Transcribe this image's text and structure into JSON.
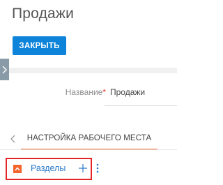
{
  "page": {
    "title": "Продажи"
  },
  "toolbar": {
    "close_label": "ЗАКРЫТЬ"
  },
  "form": {
    "name_field": {
      "label": "Название",
      "required_mark": "*",
      "value": "Продажи"
    }
  },
  "tabs": [
    {
      "label": "НАСТРОЙКА РАБОЧЕГО МЕСТА",
      "active": true
    }
  ],
  "sections": {
    "label": "Разделы",
    "collapsed_state": "expanded"
  },
  "icons": {
    "side_handle": "chevron-right-icon",
    "tab_back": "chevron-left-icon",
    "collapse": "collapse-icon",
    "add": "plus-icon",
    "more": "vertical-dots-icon"
  },
  "colors": {
    "primary_button": "#0d84d9",
    "active_tab_underline": "#f26b3a",
    "highlight_box": "#e32726",
    "collapse_toggle": "#f2652d",
    "link": "#2a7ac9",
    "required_mark": "#e53935"
  }
}
